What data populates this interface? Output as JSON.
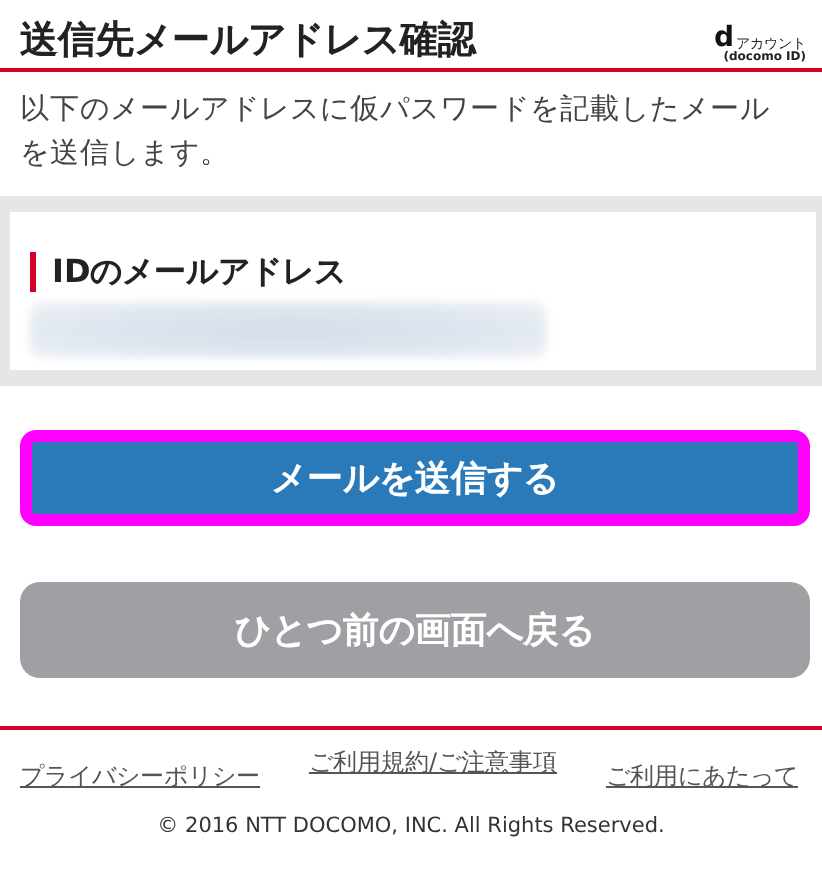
{
  "header": {
    "title": "送信先メールアドレス確認",
    "logo": {
      "letter": "d",
      "text": "アカウント",
      "subtext": "(docomo ID)"
    }
  },
  "description": "以下のメールアドレスに仮パスワードを記載したメールを送信します。",
  "email_card": {
    "label": "IDのメールアドレス",
    "value_blurred": true
  },
  "buttons": [
    {
      "label": "メールを送信する",
      "kind": "primary",
      "focused": true
    },
    {
      "label": "ひとつ前の画面へ戻る",
      "kind": "secondary",
      "focused": false
    }
  ],
  "footer": {
    "links": [
      "プライバシーポリシー",
      "ご利用規約/ご注意事項",
      "ご利用にあたって"
    ],
    "copyright": "© 2016 NTT DOCOMO, INC. All Rights Reserved."
  }
}
